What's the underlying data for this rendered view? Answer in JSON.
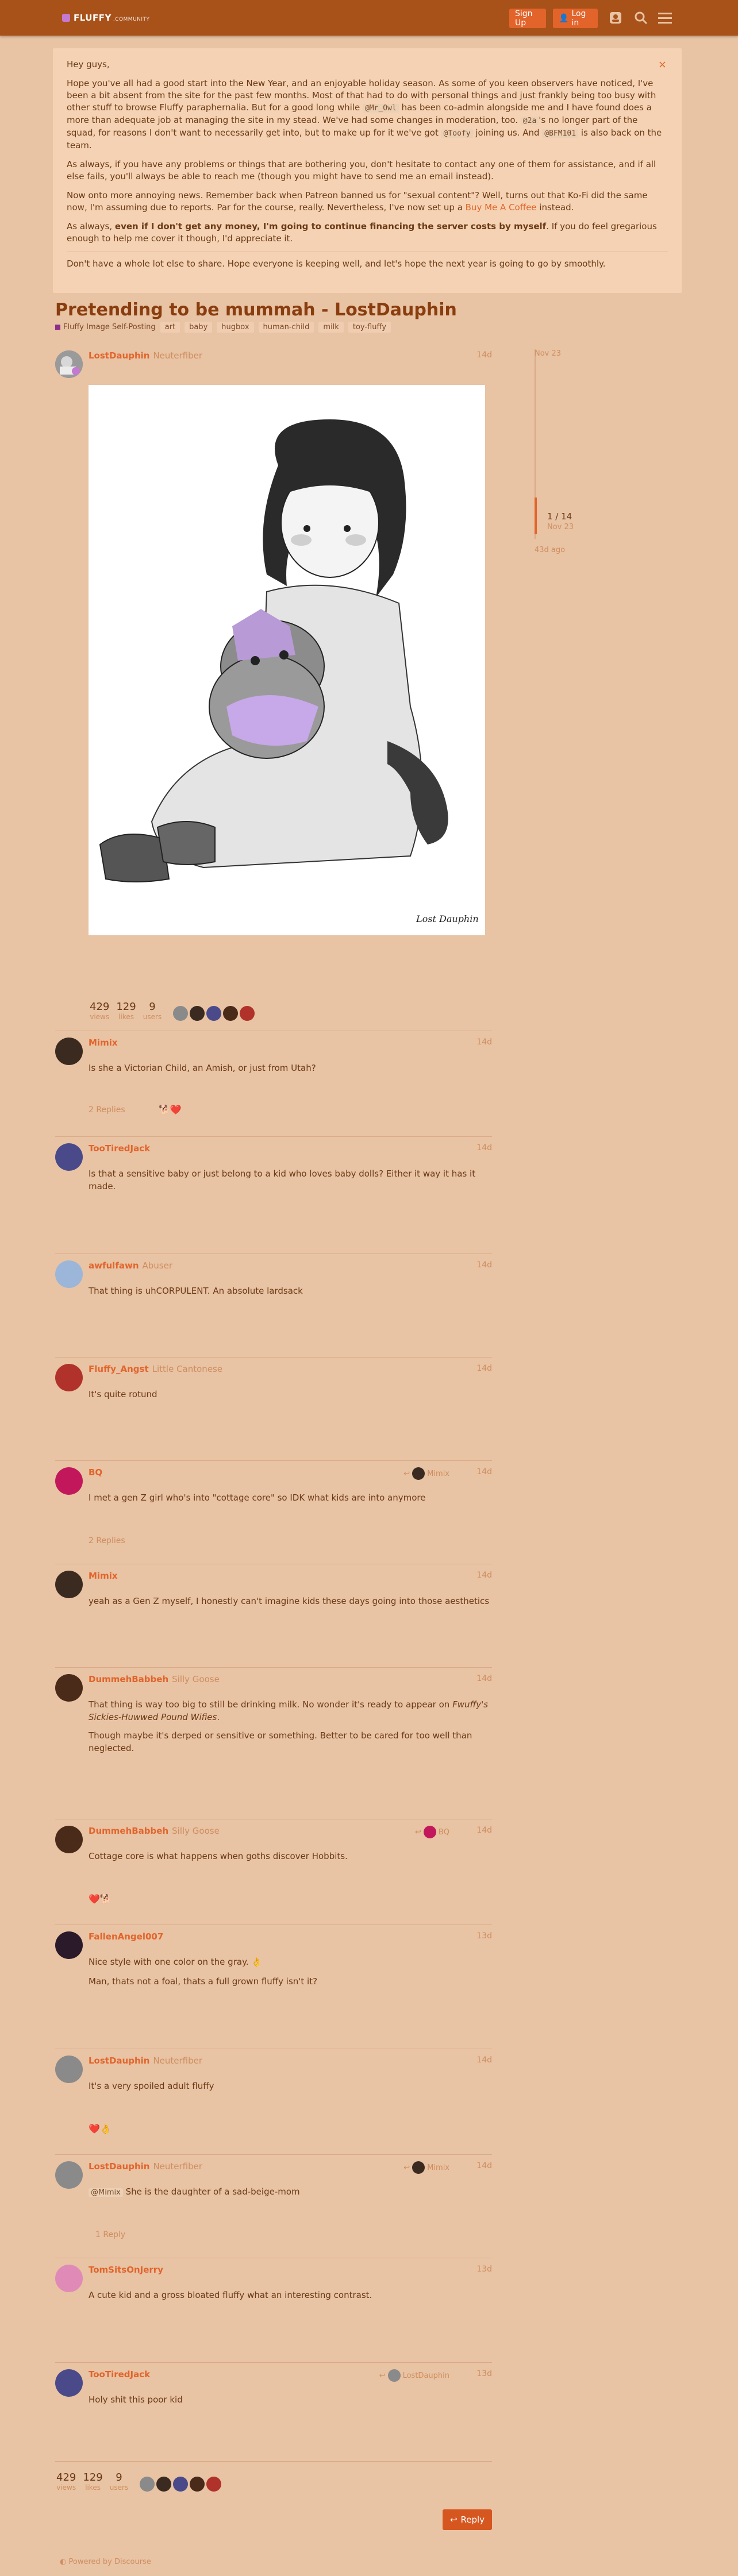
{
  "header": {
    "logo_text": "FLUFFY",
    "logo_sub": ".COMMUNITY",
    "signup_label": "Sign Up",
    "login_label": "Log in"
  },
  "banner": {
    "greeting": "Hey guys,",
    "p1_a": "Hope you've all had a good start into the New Year, and an enjoyable holiday season. As some of you keen observers have noticed, I've been a bit absent from the site for the past few months. Most of that had to do with personal things and just frankly being too busy with other stuff to browse Fluffy paraphernalia. But for a good long while",
    "p1_mention1": "@Mr_Owl",
    "p1_b": "has been co-admin alongside me and I have found does a more than adequate job at managing the site in my stead. We've had some changes in moderation, too.",
    "p1_mention2": "@2a",
    "p1_c": "'s no longer part of the squad, for reasons I don't want to necessarily get into, but to make up for it we've got",
    "p1_mention3": "@Toofy",
    "p1_d": "joining us. And",
    "p1_mention4": "@BFM101",
    "p1_e": "is also back on the team.",
    "p2": "As always, if you have any problems or things that are bothering you, don't hesitate to contact any one of them for assistance, and if all else fails, you'll always be able to reach me (though you might have to send me an email instead).",
    "p3_a": "Now onto more annoying news. Remember back when Patreon banned us for \"sexual content\"? Well, turns out that Ko-Fi did the same now, I'm assuming due to reports. Par for the course, really. Nevertheless, I've now set up a",
    "p3_link": "Buy Me A Coffee",
    "p3_b": "instead.",
    "p4_a": "As always,",
    "p4_bold": "even if I don't get any money, I'm going to continue financing the server costs by myself",
    "p4_b": ". If you do feel gregarious enough to help me cover it though, I'd appreciate it.",
    "p5": "Don't have a whole lot else to share. Hope everyone is keeping well, and let's hope the next year is going to go by smoothly.",
    "close_icon": "×"
  },
  "topic": {
    "title": "Pretending to be mummah - LostDauphin",
    "category": "Fluffy Image Self-Posting",
    "tags": [
      "art",
      "baby",
      "hugbox",
      "human-child",
      "milk",
      "toy-fluffy"
    ]
  },
  "timeline": {
    "start": "Nov 23",
    "position": "1 / 14",
    "current_date": "Nov 23",
    "ago": "43d ago"
  },
  "op": {
    "username": "LostDauphin",
    "user_title": "Neuterfiber",
    "date": "14d",
    "signature": "Lost Dauphin"
  },
  "stats": {
    "views_n": "429",
    "views_l": "views",
    "likes_n": "129",
    "likes_l": "likes",
    "users_n": "9",
    "users_l": "users"
  },
  "posts": [
    {
      "username": "Mimix",
      "title": "",
      "date": "14d",
      "text": "Is she a Victorian Child, an Amish, or just from Utah?",
      "replies": "2 Replies",
      "reactions": "🐕❤️",
      "color": "#3b2a20"
    },
    {
      "username": "TooTiredJack",
      "title": "",
      "date": "14d",
      "text": "Is that a sensitive baby or just belong to a kid who loves baby dolls? Either it way it has it made.",
      "color": "#4a4a8a"
    },
    {
      "username": "awfulfawn",
      "title": "Abuser",
      "date": "14d",
      "text": "That thing is uhCORPULENT. An absolute lardsack",
      "color": "#9bb6d8"
    },
    {
      "username": "Fluffy_Angst",
      "title": "Little Cantonese",
      "date": "14d",
      "text": "It's quite rotund",
      "color": "#b0322a"
    },
    {
      "username": "BQ",
      "title": "",
      "date": "14d",
      "text": "I met a gen Z girl who's into \"cottage core\" so IDK what kids are into anymore",
      "replies": "2 Replies",
      "reply_to": "Mimix",
      "color": "#c2185b"
    },
    {
      "username": "Mimix",
      "title": "",
      "date": "14d",
      "text": "yeah as a Gen Z myself, I honestly can't imagine kids these days going into those aesthetics",
      "color": "#3b2a20"
    },
    {
      "username": "DummehBabbeh",
      "title": "Silly Goose",
      "date": "14d",
      "text1": "That thing is way too big to still be drinking milk. No wonder it's ready to appear on",
      "text1_em": "Fwuffy's Sickies-Huwwed Pound Wifies",
      "text1_end": ".",
      "text2": "Though maybe it's derped or sensitive or something. Better to be cared for too well than neglected.",
      "color": "#4a2a18"
    },
    {
      "username": "DummehBabbeh",
      "title": "Silly Goose",
      "date": "14d",
      "text": "Cottage core is what happens when goths discover Hobbits.",
      "reactions": "❤️🐕",
      "reply_to": "BQ",
      "color": "#4a2a18"
    },
    {
      "username": "FallenAngel007",
      "title": "",
      "date": "13d",
      "text1": "Nice style with one color on the gray. 👌",
      "text2": "Man, thats not a foal, thats a full grown fluffy isn't it?",
      "color": "#2a1a2a"
    },
    {
      "username": "LostDauphin",
      "title": "Neuterfiber",
      "date": "14d",
      "text": "It's a very spoiled adult fluffy",
      "reactions": "❤️👌",
      "color": "#777"
    },
    {
      "username": "LostDauphin",
      "title": "Neuterfiber",
      "date": "14d",
      "mention": "@Mimix",
      "text": "She is the daughter of a sad-beige-mom",
      "replies": "1 Reply",
      "reply_to": "Mimix",
      "color": "#777"
    },
    {
      "username": "TomSitsOnJerry",
      "title": "",
      "date": "13d",
      "text": "A cute kid and a gross bloated fluffy what an interesting contrast.",
      "color": "#e08ab8"
    },
    {
      "username": "TooTiredJack",
      "title": "",
      "date": "13d",
      "text": "Holy shit this poor kid",
      "reply_to": "LostDauphin",
      "color": "#4a4a8a"
    }
  ],
  "reply_button": "Reply",
  "footer": "Powered by Discourse"
}
